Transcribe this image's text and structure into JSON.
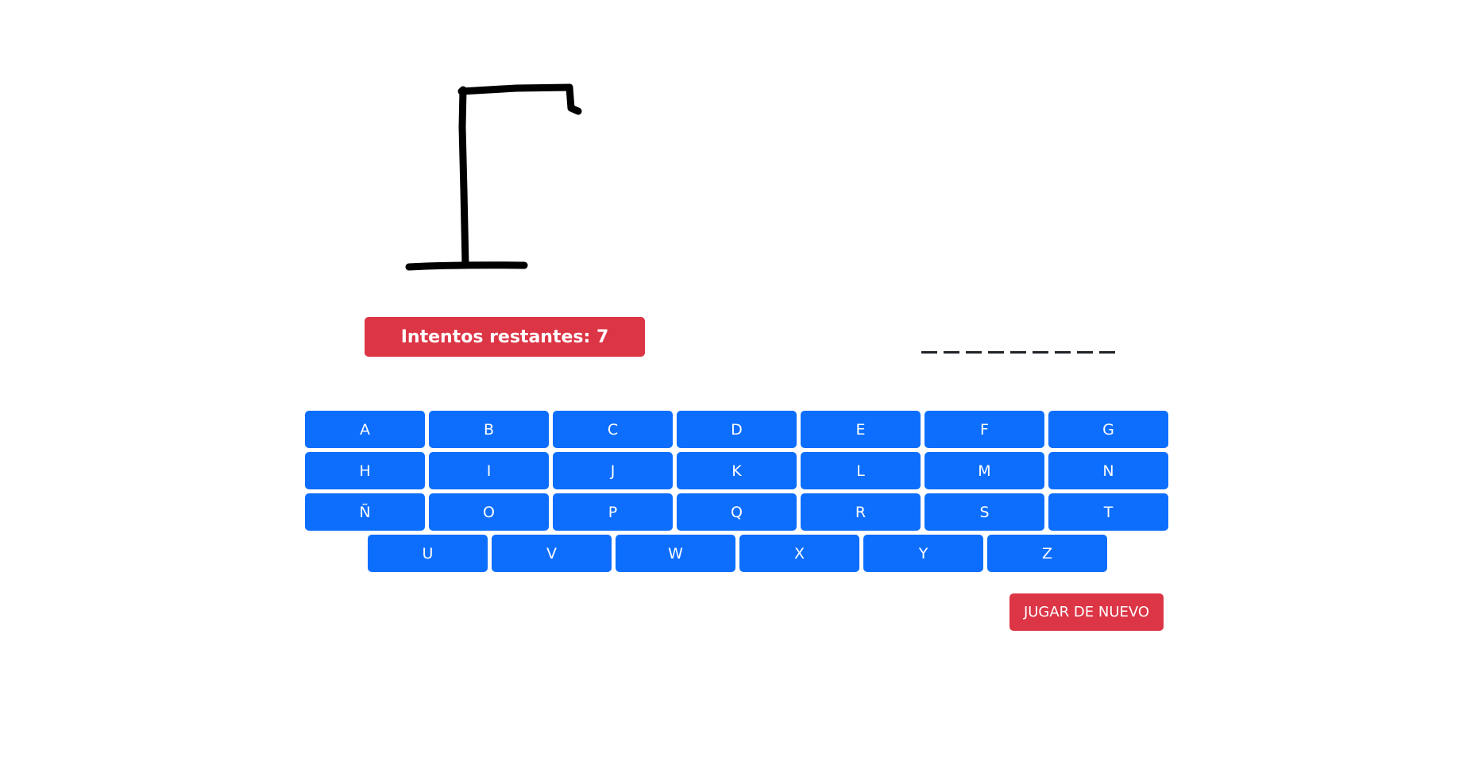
{
  "status": {
    "attempts_label": "Intentos restantes: 7"
  },
  "word": {
    "slots": [
      "_",
      "_",
      "_",
      "_",
      "_",
      "_",
      "_",
      "_",
      "_"
    ]
  },
  "keyboard": {
    "rows": [
      [
        "A",
        "B",
        "C",
        "D",
        "E",
        "F",
        "G"
      ],
      [
        "H",
        "I",
        "J",
        "K",
        "L",
        "M",
        "N"
      ],
      [
        "Ñ",
        "O",
        "P",
        "Q",
        "R",
        "S",
        "T"
      ],
      [
        "U",
        "V",
        "W",
        "X",
        "Y",
        "Z"
      ]
    ]
  },
  "actions": {
    "reset_label": "JUGAR DE NUEVO"
  },
  "colors": {
    "key_bg": "#0d6efd",
    "danger": "#dc3545",
    "text_light": "#ffffff"
  },
  "icons": {
    "gallows": "hangman-gallows-icon"
  }
}
